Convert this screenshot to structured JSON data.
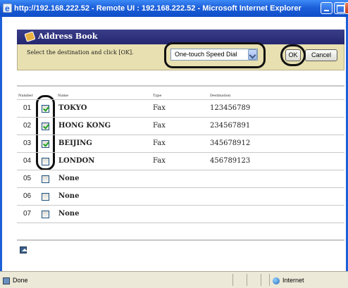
{
  "window": {
    "title": "http://192.168.222.52 - Remote UI : 192.168.222.52 - Microsoft Internet Explorer"
  },
  "header": {
    "title": "Address Book",
    "instruction": "Select the destination and click [OK].",
    "dropdown_value": "One-touch Speed Dial",
    "ok_label": "OK",
    "cancel_label": "Cancel"
  },
  "table": {
    "columns": [
      "Number",
      "Name",
      "Type",
      "Destination"
    ],
    "rows": [
      {
        "number": "01",
        "checked": true,
        "name": "TOKYO",
        "type": "Fax",
        "destination": "123456789"
      },
      {
        "number": "02",
        "checked": true,
        "name": "HONG KONG",
        "type": "Fax",
        "destination": "234567891"
      },
      {
        "number": "03",
        "checked": true,
        "name": "BEIJING",
        "type": "Fax",
        "destination": "345678912"
      },
      {
        "number": "04",
        "checked": false,
        "name": "LONDON",
        "type": "Fax",
        "destination": "456789123"
      },
      {
        "number": "05",
        "checked": false,
        "name": "None",
        "type": "",
        "destination": ""
      },
      {
        "number": "06",
        "checked": false,
        "name": "None",
        "type": "",
        "destination": ""
      },
      {
        "number": "07",
        "checked": false,
        "name": "None",
        "type": "",
        "destination": ""
      }
    ]
  },
  "statusbar": {
    "status": "Done",
    "zone": "Internet"
  }
}
